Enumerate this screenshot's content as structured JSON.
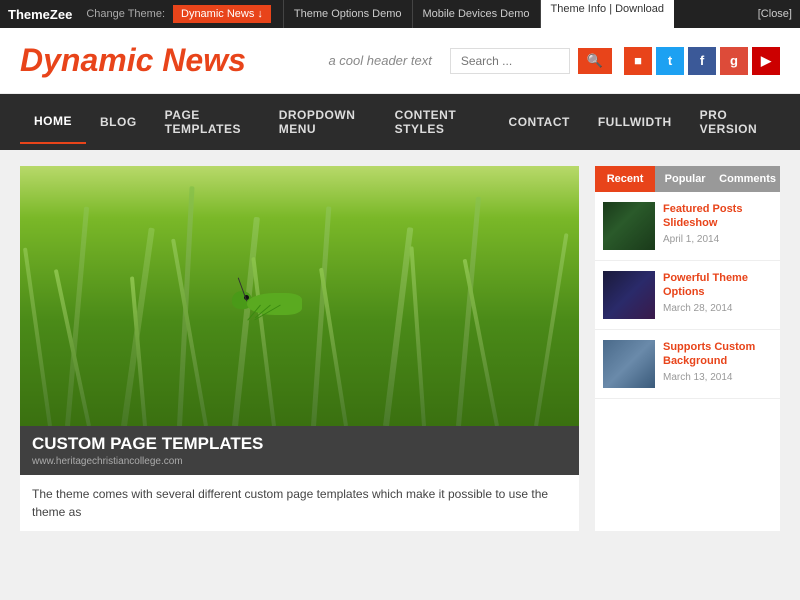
{
  "adminBar": {
    "brand": "ThemeZee",
    "changeTheme": "Change Theme:",
    "currentTheme": "Dynamic News ↓",
    "links": [
      {
        "label": "Theme Options Demo",
        "id": "theme-options-demo"
      },
      {
        "label": "Mobile Devices Demo",
        "id": "mobile-devices-demo"
      }
    ],
    "themeInfo": "Theme Info | Download",
    "close": "[Close]"
  },
  "header": {
    "siteTitle": "Dynamic News",
    "tagline": "a cool header text",
    "searchPlaceholder": "Search ...",
    "searchLabel": "Search"
  },
  "nav": {
    "items": [
      {
        "label": "HOME",
        "active": true
      },
      {
        "label": "BLOG",
        "active": false
      },
      {
        "label": "PAGE TEMPLATES",
        "active": false
      },
      {
        "label": "DROPDOWN MENU",
        "active": false
      },
      {
        "label": "CONTENT STYLES",
        "active": false
      },
      {
        "label": "CONTACT",
        "active": false
      },
      {
        "label": "FULLWIDTH",
        "active": false
      },
      {
        "label": "PRO VERSION",
        "active": false
      }
    ]
  },
  "article": {
    "title": "CUSTOM PAGE TEMPLATES",
    "url": "www.heritagechristiancollege.com",
    "excerpt": "The theme comes with several different custom page templates which make it possible to use the theme as"
  },
  "sidebar": {
    "tabs": [
      {
        "label": "Recent",
        "active": true
      },
      {
        "label": "Popular",
        "active": false
      },
      {
        "label": "Comments",
        "active": false
      }
    ],
    "posts": [
      {
        "title": "Featured Posts Slideshow",
        "date": "April 1, 2014",
        "thumbType": "butterfly"
      },
      {
        "title": "Powerful Theme Options",
        "date": "March 28, 2014",
        "thumbType": "flowers"
      },
      {
        "title": "Supports Custom Background",
        "date": "March 13, 2014",
        "thumbType": "bird"
      }
    ]
  },
  "social": [
    {
      "label": "RSS",
      "class": "social-rss",
      "icon": "⊕"
    },
    {
      "label": "Twitter",
      "class": "social-tw",
      "icon": "t"
    },
    {
      "label": "Facebook",
      "class": "social-fb",
      "icon": "f"
    },
    {
      "label": "Google+",
      "class": "social-gp",
      "icon": "g"
    },
    {
      "label": "YouTube",
      "class": "social-yt",
      "icon": "▶"
    }
  ]
}
